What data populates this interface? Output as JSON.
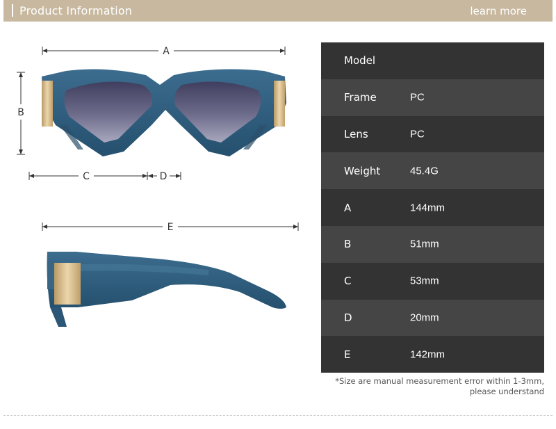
{
  "header": {
    "title": "Product Information",
    "link": "learn more"
  },
  "dimensions": {
    "a": "A",
    "b": "B",
    "c": "C",
    "d": "D",
    "e": "E"
  },
  "specs": [
    {
      "key": "Model",
      "value": ""
    },
    {
      "key": "Frame",
      "value": "PC"
    },
    {
      "key": "Lens",
      "value": "PC"
    },
    {
      "key": "Weight",
      "value": "45.4G"
    },
    {
      "key": "A",
      "value": "144mm"
    },
    {
      "key": "B",
      "value": "51mm"
    },
    {
      "key": "C",
      "value": "53mm"
    },
    {
      "key": "D",
      "value": "20mm"
    },
    {
      "key": "E",
      "value": "142mm"
    }
  ],
  "note": {
    "line1": "*Size are manual measurement error within 1-3mm,",
    "line2": "please understand"
  },
  "colors": {
    "header": "#c7b89f",
    "frame": "#2f5a7a",
    "lens": "#5b5a7a",
    "hinge": "#d4b98a",
    "table_dark": "#333333",
    "table_light": "#454545"
  }
}
